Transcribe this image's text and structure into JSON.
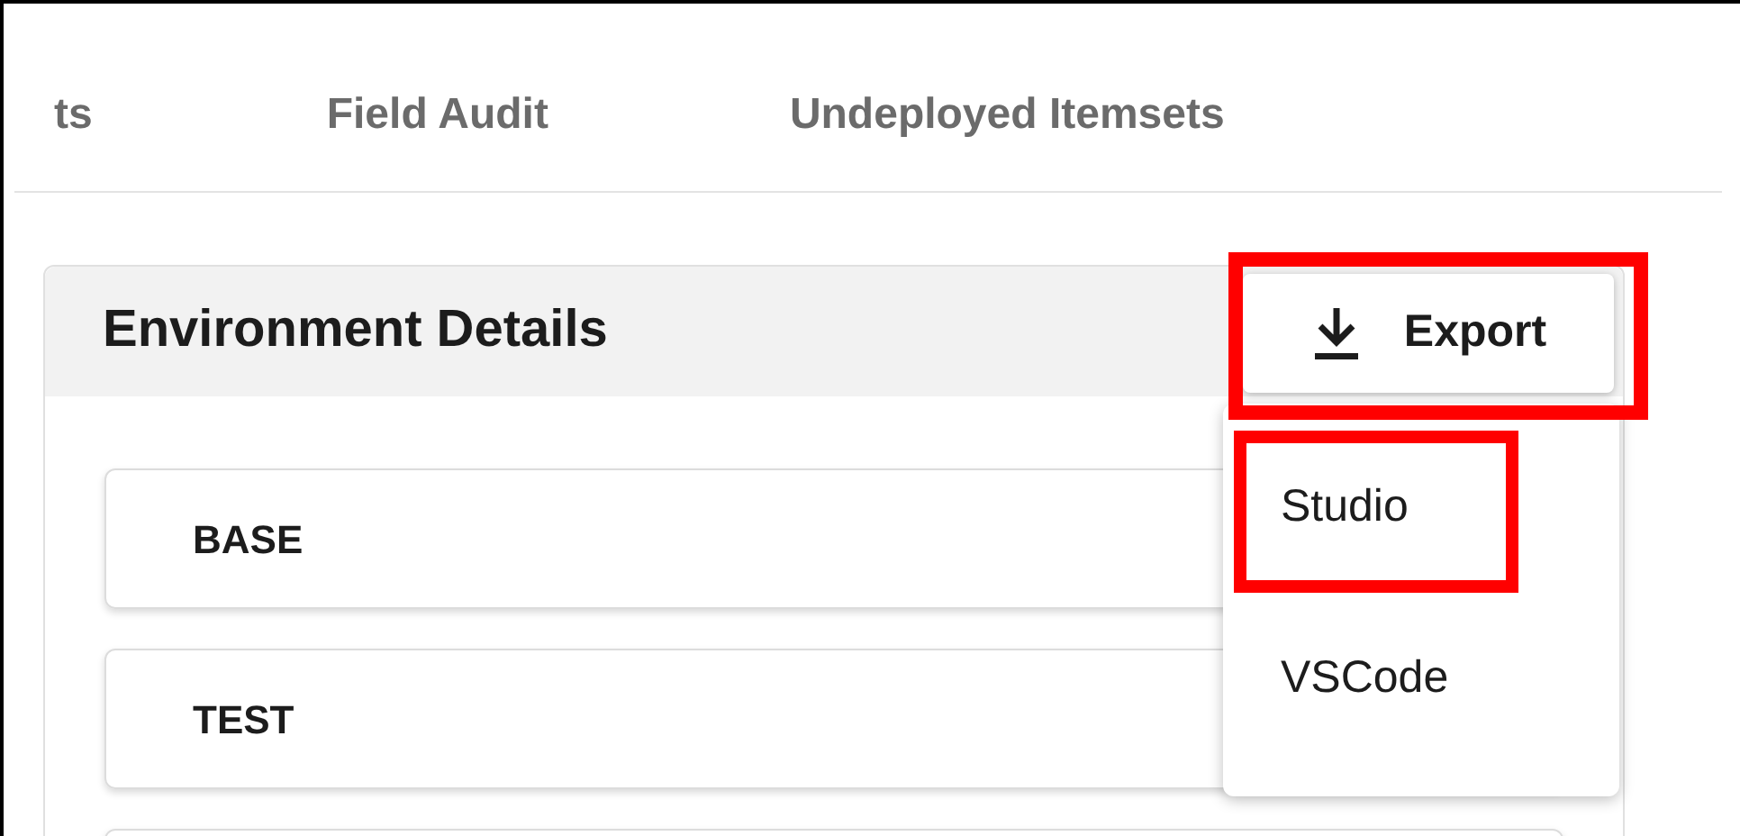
{
  "tabs": [
    {
      "label": "ts"
    },
    {
      "label": "Field Audit"
    },
    {
      "label": "Undeployed Itemsets"
    }
  ],
  "card": {
    "title": "Environment Details",
    "export_button": "Export",
    "menu": [
      {
        "label": "Studio",
        "highlighted": true
      },
      {
        "label": "VSCode",
        "highlighted": false
      }
    ],
    "rows": [
      {
        "label": "BASE"
      },
      {
        "label": "TEST"
      },
      {
        "label": ""
      }
    ]
  }
}
